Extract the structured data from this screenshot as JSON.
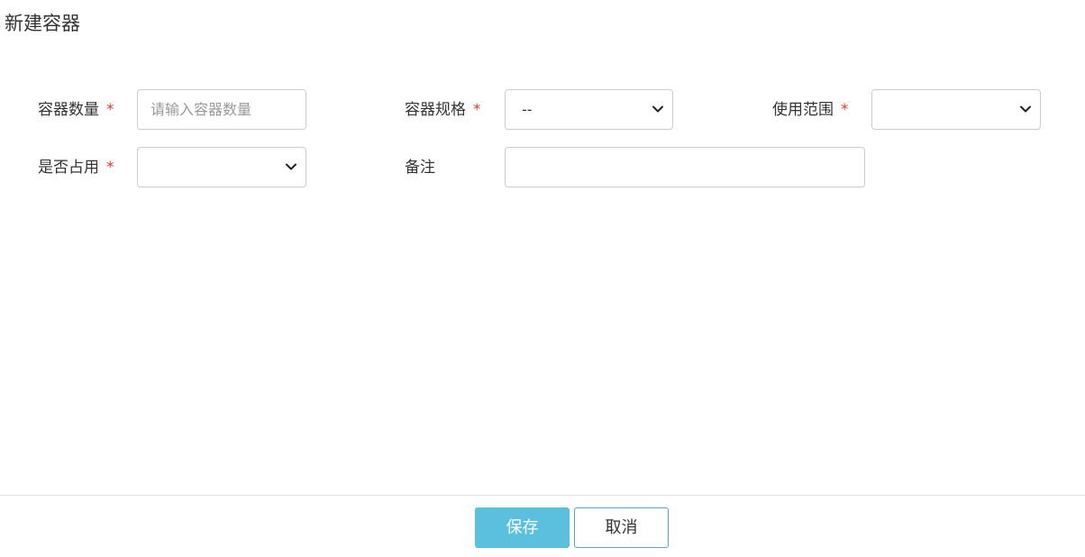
{
  "page": {
    "title": "新建容器"
  },
  "form": {
    "container_count": {
      "label": "容器数量",
      "required_mark": "*",
      "value": "",
      "placeholder": "请输入容器数量"
    },
    "container_spec": {
      "label": "容器规格",
      "required_mark": "*",
      "selected": "--"
    },
    "usage_scope": {
      "label": "使用范围",
      "required_mark": "*",
      "selected": ""
    },
    "occupied": {
      "label": "是否占用",
      "required_mark": "*",
      "selected": ""
    },
    "remark": {
      "label": "备注",
      "value": ""
    }
  },
  "footer": {
    "save_label": "保存",
    "cancel_label": "取消"
  },
  "colors": {
    "required": "#e53935",
    "primary": "#5bc0de",
    "border": "#cccccc"
  },
  "icons": {
    "select_arrow": "chevron-down-icon"
  }
}
